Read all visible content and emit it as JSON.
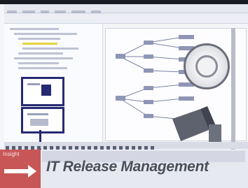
{
  "banner": {
    "title": "IT Release Management",
    "tag": "Insight"
  },
  "colors": {
    "frame_border": "#262a72",
    "red_block": "#c85656",
    "title_text": "#4b4f59",
    "highlight": "#e8d23c"
  },
  "icons": [
    "arrow-right-icon",
    "lens-icon",
    "magnifier-icon"
  ]
}
